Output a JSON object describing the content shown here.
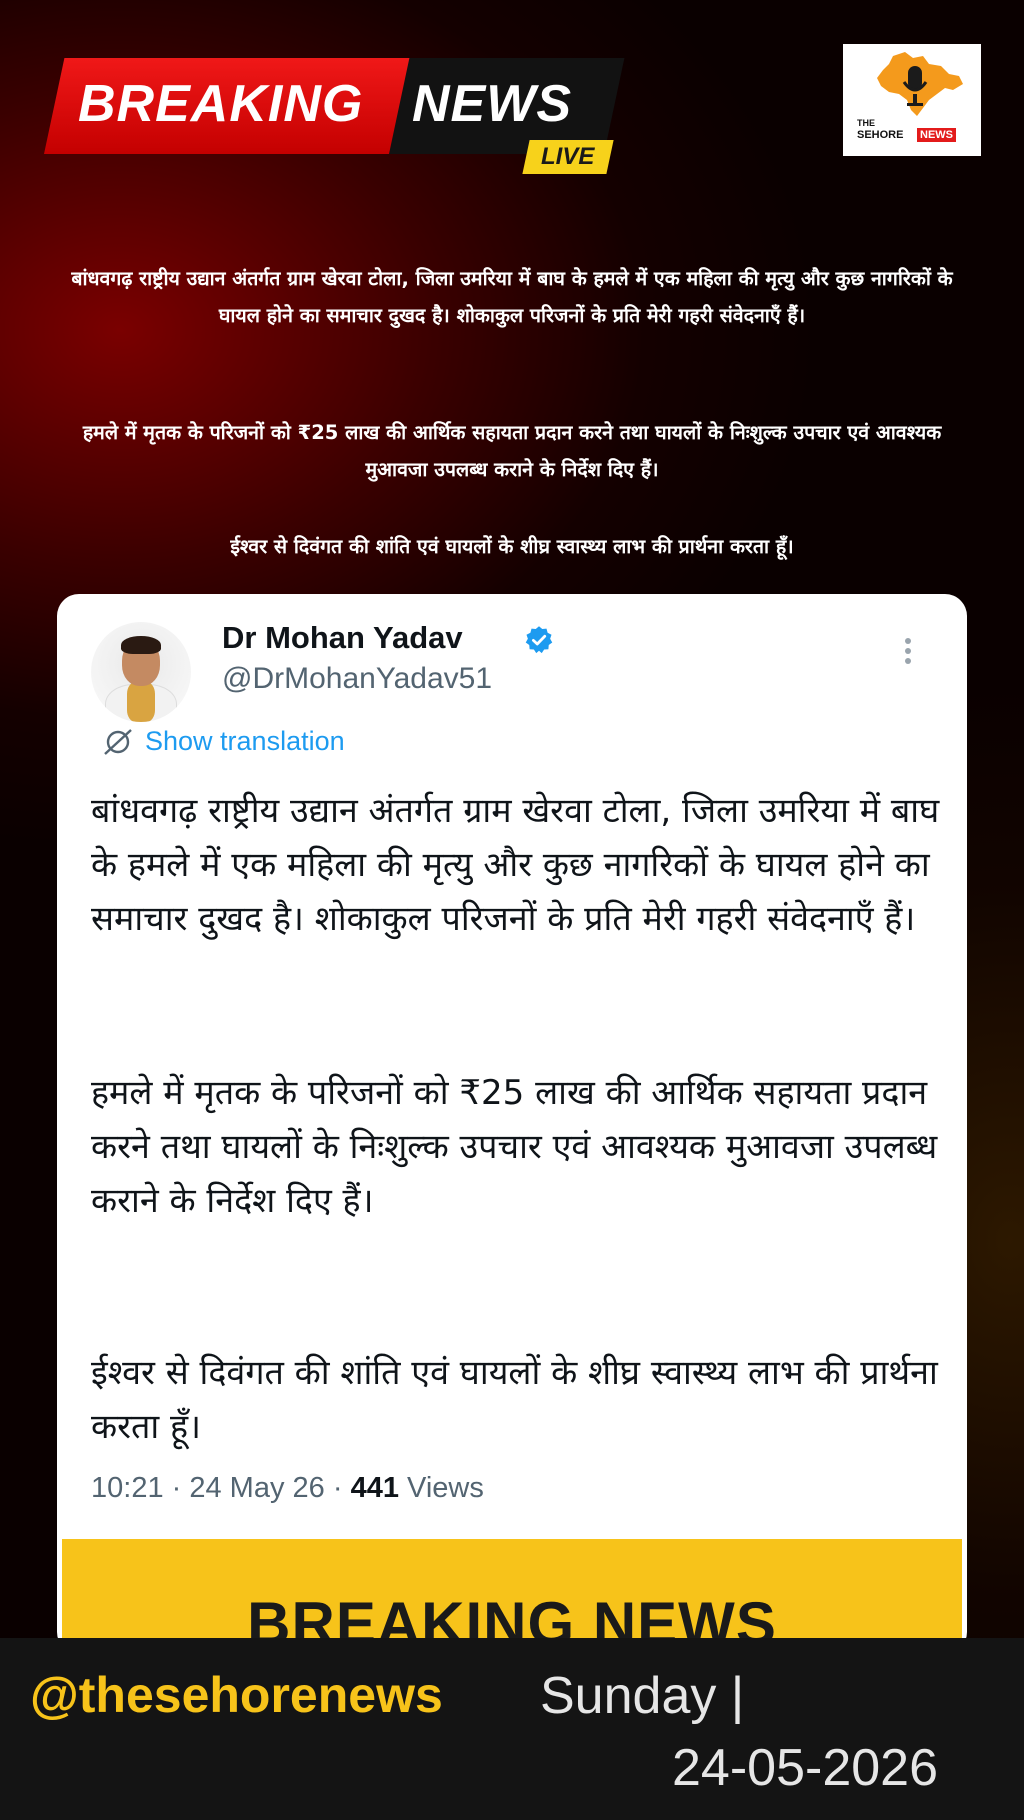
{
  "banner": {
    "word1": "BREAKING",
    "word2": "NEWS",
    "live": "LIVE",
    "colors": {
      "red": "#e11010",
      "dark": "#121212",
      "yellow": "#f7d21b"
    }
  },
  "logo": {
    "line1": "THE",
    "line2": "SEHORE",
    "badge": "NEWS",
    "icon": "india-map-microphone-icon"
  },
  "lead": {
    "p1": "बांधवगढ़ राष्ट्रीय उद्यान अंतर्गत ग्राम खेरवा टोला, जिला उमरिया में बाघ के हमले में एक महिला की मृत्यु और कुछ नागरिकों के घायल होने का समाचार दुखद है। शोकाकुल परिजनों के प्रति मेरी गहरी संवेदनाएँ हैं।",
    "p2": "हमले में मृतक के परिजनों को ₹25 लाख की आर्थिक सहायता प्रदान करने तथा घायलों के निःशुल्क उपचार एवं आवश्यक मुआवजा उपलब्ध कराने के निर्देश दिए हैं।",
    "p3": "ईश्वर से दिवंगत की शांति एवं घायलों के शीघ्र स्वास्थ्य लाभ की प्रार्थना करता हूँ।"
  },
  "tweet": {
    "name": "Dr Mohan Yadav",
    "handle": "@DrMohanYadav51",
    "show_translation": "Show translation",
    "p1": "बांधवगढ़ राष्ट्रीय उद्यान अंतर्गत ग्राम खेरवा टोला, जिला उमरिया में बाघ के हमले में एक महिला की मृत्यु और कुछ नागरिकों के घायल होने का समाचार दुखद है। शोकाकुल परिजनों के प्रति मेरी गहरी संवेदनाएँ हैं।",
    "p2": "हमले में मृतक के परिजनों को ₹25 लाख की आर्थिक सहायता प्रदान करने तथा घायलों के निःशुल्क उपचार एवं आवश्यक मुआवजा उपलब्ध कराने के निर्देश दिए हैं।",
    "p3": "ईश्वर से दिवंगत की शांति एवं घायलों के शीघ्र स्वास्थ्य लाभ की प्रार्थना करता हूँ।",
    "time": "10:21",
    "date": "24 May 26",
    "views_count": "441",
    "views_label": "Views",
    "verified_color": "#1d9bf0"
  },
  "strip": {
    "text": "BREAKING NEWS",
    "color": "#f7c31a"
  },
  "footer": {
    "handle": "@thesehorenews",
    "day": "Sunday |",
    "date": "24-05-2026"
  }
}
